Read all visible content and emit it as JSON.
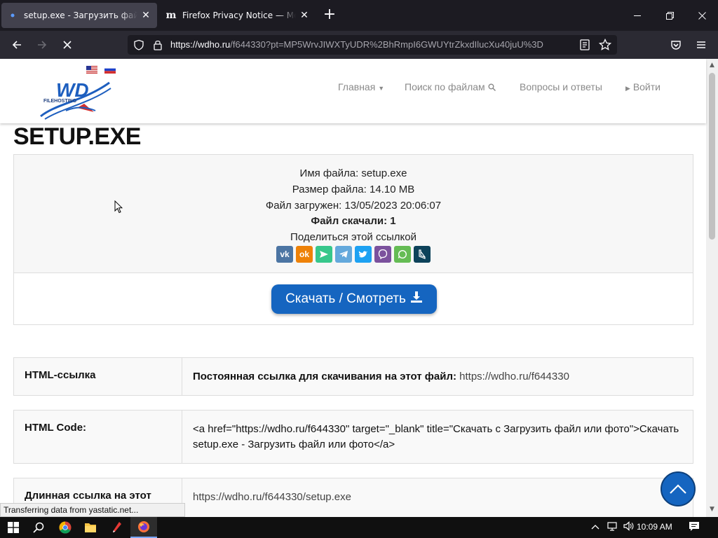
{
  "browser": {
    "tabs": [
      {
        "title": "setup.exe - Загрузить файл или фото",
        "active": true
      },
      {
        "title": "Firefox Privacy Notice — Mozilla",
        "active": false
      }
    ],
    "url_main": "https://wdho.ru",
    "url_rest": "/f644330?pt=MP5WrvJIWXTyUDR%2BhRmpI6GWUYtrZkxdIlucXu40juU%3D",
    "status_text": "Transferring data from yastatic.net..."
  },
  "site": {
    "logo_text": "WD",
    "logo_subtext": "FILEHOSTING",
    "menu": {
      "home": "Главная",
      "search": "Поиск по файлам",
      "faq": "Вопросы и ответы",
      "login": "Войти"
    },
    "page_title": "SETUP.EXE",
    "file_info": {
      "name_label": "Имя файла:",
      "name_value": "setup.exe",
      "size_label": "Размер файла:",
      "size_value": "14.10 MB",
      "uploaded_label": "Файл загружен:",
      "uploaded_value": "13/05/2023 20:06:07",
      "downloads_text": "Файл скачали: 1",
      "share_text": "Поделиться этой ссылкой"
    },
    "share_icons": [
      "vk-icon",
      "odnoklassniki-icon",
      "send-icon",
      "telegram-icon",
      "twitter-icon",
      "viber-icon",
      "whatsapp-icon",
      "livejournal-icon"
    ],
    "download_button": "Скачать / Смотреть",
    "rows": {
      "html_link": {
        "label": "HTML-ссылка",
        "prefix": "Постоянная ссылка для скачивания на этот файл:",
        "value": "https://wdho.ru/f644330"
      },
      "html_code": {
        "label": "HTML Code:",
        "value": "<a href=\"https://wdho.ru/f644330\" target=\"_blank\" title=\"Скачать с Загрузить файл или фото\">Скачать setup.exe - Загрузить файл или фото</a>"
      },
      "long_link": {
        "label": "Длинная ссылка на этот",
        "value": "https://wdho.ru/f644330/setup.exe"
      }
    }
  },
  "taskbar": {
    "time": "10:09 AM"
  },
  "colors": {
    "accent": "#1565c0",
    "tabbar": "#1c1b22",
    "navbar": "#2b2a33"
  }
}
